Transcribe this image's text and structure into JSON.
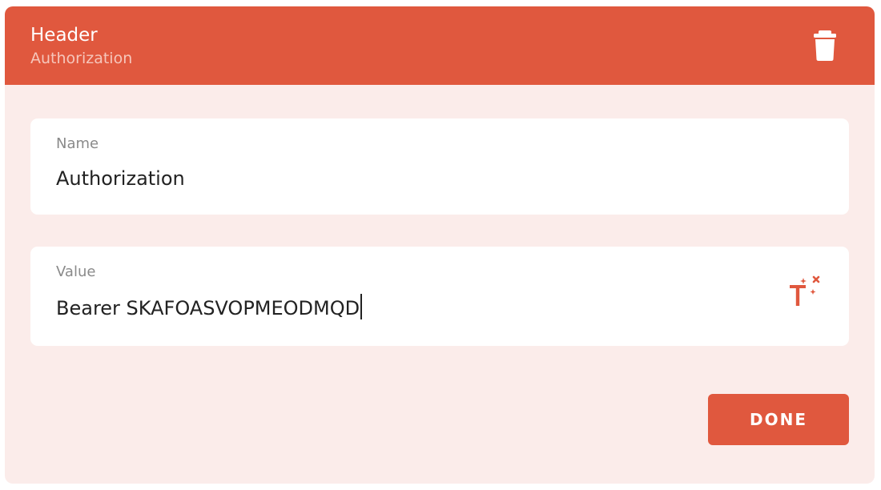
{
  "header": {
    "title": "Header",
    "subtitle": "Authorization",
    "delete_icon": "trash-icon",
    "background_color": "#e0583e"
  },
  "fields": {
    "name": {
      "label": "Name",
      "value": "Authorization"
    },
    "value": {
      "label": "Value",
      "value": "Bearer SKAFOASVOPMEODMQD",
      "action_icon": "template-variable-icon"
    }
  },
  "actions": {
    "done_label": "DONE"
  },
  "colors": {
    "accent": "#e0583e",
    "panel_background": "#fbecea",
    "field_background": "#ffffff"
  }
}
